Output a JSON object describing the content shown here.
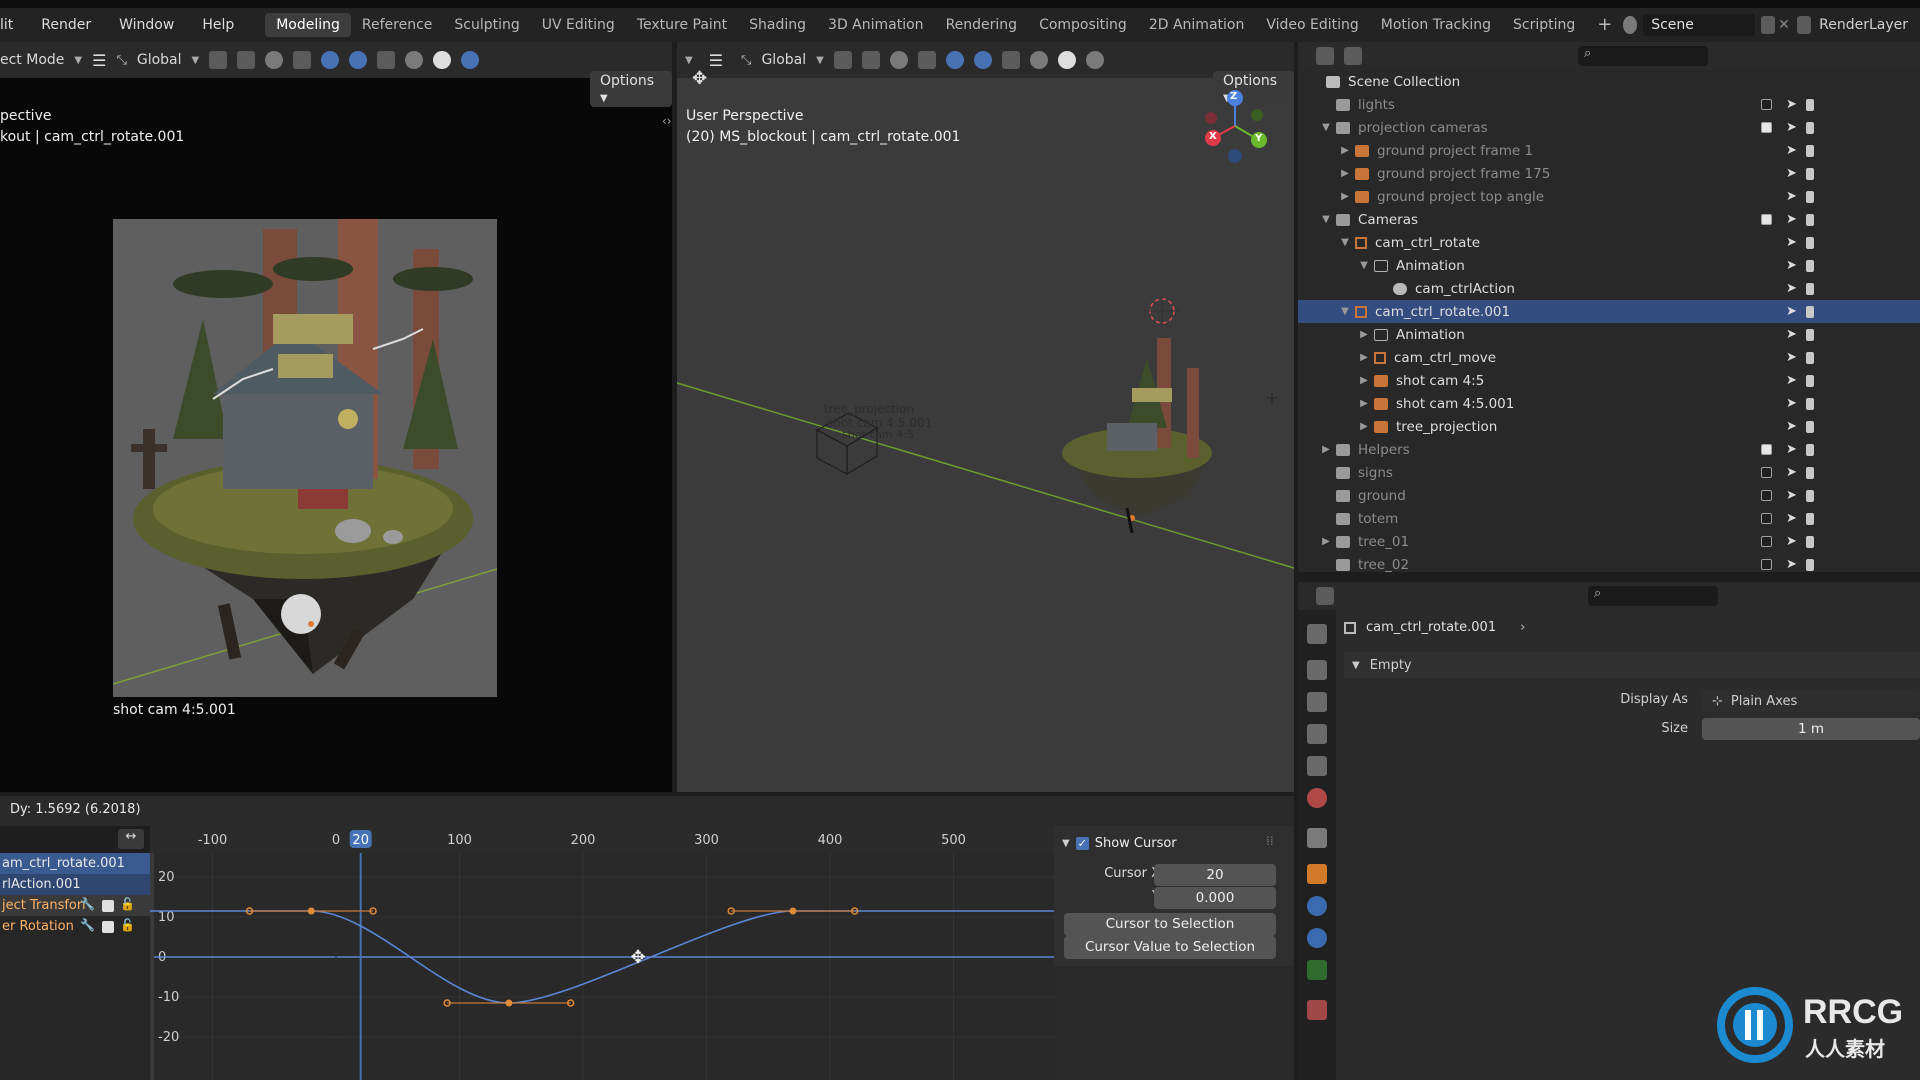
{
  "menubar": {
    "menus": [
      "lit",
      "Render",
      "Window",
      "Help"
    ],
    "workspace_tabs": [
      "Modeling",
      "Reference",
      "Sculpting",
      "UV Editing",
      "Texture Paint",
      "Shading",
      "3D Animation",
      "Rendering",
      "Compositing",
      "2D Animation",
      "Video Editing",
      "Motion Tracking",
      "Scripting"
    ],
    "active_workspace": "Modeling",
    "add_tab": "+",
    "scene_name": "Scene",
    "view_layer": "RenderLayer"
  },
  "left_viewport": {
    "mode": "ect Mode",
    "orientation": "Global",
    "options_label": "Options",
    "perspective_label": "pective",
    "object_label": "kout | cam_ctrl_rotate.001",
    "camera_caption": "shot cam 4:5.001"
  },
  "right_viewport": {
    "orientation": "Global",
    "options_label": "Options",
    "perspective_label": "User Perspective",
    "object_label": "(20) MS_blockout | cam_ctrl_rotate.001",
    "ghost_labels": [
      "tree_projection",
      "shot cam 4:5.001",
      "shot cam 4:5"
    ],
    "gizmo_axes": [
      "Z",
      "Y",
      "X"
    ]
  },
  "outliner": {
    "title": "Scene Collection",
    "rows": [
      {
        "label": "lights",
        "depth": 1,
        "tri": "",
        "icon": "collection",
        "dim": true,
        "check": false,
        "selected": false
      },
      {
        "label": "projection cameras",
        "depth": 1,
        "tri": "▼",
        "icon": "collection",
        "dim": true,
        "check": true,
        "selected": false
      },
      {
        "label": "ground project frame 1",
        "depth": 2,
        "tri": "▶",
        "icon": "camera",
        "dim": true,
        "check": null,
        "selected": false
      },
      {
        "label": "ground project frame 175",
        "depth": 2,
        "tri": "▶",
        "icon": "camera",
        "dim": true,
        "check": null,
        "selected": false
      },
      {
        "label": "ground project top angle",
        "depth": 2,
        "tri": "▶",
        "icon": "camera",
        "dim": true,
        "check": null,
        "selected": false
      },
      {
        "label": "Cameras",
        "depth": 1,
        "tri": "▼",
        "icon": "collection",
        "dim": false,
        "check": true,
        "selected": false
      },
      {
        "label": "cam_ctrl_rotate",
        "depth": 2,
        "tri": "▼",
        "icon": "empty",
        "dim": false,
        "check": null,
        "selected": false
      },
      {
        "label": "Animation",
        "depth": 3,
        "tri": "▼",
        "icon": "anim",
        "dim": false,
        "check": null,
        "selected": false
      },
      {
        "label": "cam_ctrlAction",
        "depth": 4,
        "tri": "",
        "icon": "action",
        "dim": false,
        "check": null,
        "selected": false
      },
      {
        "label": "cam_ctrl_rotate.001",
        "depth": 2,
        "tri": "▼",
        "icon": "empty",
        "dim": false,
        "check": null,
        "selected": true
      },
      {
        "label": "Animation",
        "depth": 3,
        "tri": "▶",
        "icon": "anim",
        "dim": false,
        "check": null,
        "selected": false
      },
      {
        "label": "cam_ctrl_move",
        "depth": 3,
        "tri": "▶",
        "icon": "empty",
        "dim": false,
        "check": null,
        "selected": false
      },
      {
        "label": "shot cam 4:5",
        "depth": 3,
        "tri": "▶",
        "icon": "camera",
        "dim": false,
        "check": null,
        "selected": false
      },
      {
        "label": "shot cam 4:5.001",
        "depth": 3,
        "tri": "▶",
        "icon": "camera",
        "dim": false,
        "check": null,
        "selected": false
      },
      {
        "label": "tree_projection",
        "depth": 3,
        "tri": "▶",
        "icon": "camera",
        "dim": false,
        "check": null,
        "selected": false
      },
      {
        "label": "Helpers",
        "depth": 1,
        "tri": "▶",
        "icon": "collection",
        "dim": true,
        "check": true,
        "selected": false
      },
      {
        "label": "signs",
        "depth": 1,
        "tri": "",
        "icon": "collection",
        "dim": true,
        "check": false,
        "selected": false
      },
      {
        "label": "ground",
        "depth": 1,
        "tri": "",
        "icon": "collection",
        "dim": true,
        "check": false,
        "selected": false
      },
      {
        "label": "totem",
        "depth": 1,
        "tri": "",
        "icon": "collection",
        "dim": true,
        "check": false,
        "selected": false
      },
      {
        "label": "tree_01",
        "depth": 1,
        "tri": "▶",
        "icon": "collection",
        "dim": true,
        "check": false,
        "selected": false
      },
      {
        "label": "tree_02",
        "depth": 1,
        "tri": "",
        "icon": "collection",
        "dim": true,
        "check": false,
        "selected": false
      }
    ]
  },
  "properties": {
    "object_name": "cam_ctrl_rotate.001",
    "breadcrumb_arrow": "›",
    "panel_title": "Empty",
    "display_as_label": "Display As",
    "display_as_value": "Plain Axes",
    "size_label": "Size",
    "size_value": "1 m"
  },
  "graph_editor": {
    "status": "Dy: 1.5692 (6.2018)",
    "current_frame": "20",
    "frame_ticks": [
      "-100",
      "0",
      "100",
      "200",
      "300",
      "400",
      "500"
    ],
    "value_ticks": [
      "20",
      "10",
      "0",
      "-10",
      "-20"
    ],
    "channels": [
      "am_ctrl_rotate.001",
      "rlAction.001",
      "ject Transforr",
      "er Rotation"
    ],
    "show_cursor_label": "Show Cursor",
    "cursor_x_label": "Cursor X",
    "cursor_x_value": "20",
    "cursor_y_label": "Y",
    "cursor_y_value": "0.000",
    "cursor_to_selection": "Cursor to Selection",
    "cursor_value_to_selection": "Cursor Value to Selection",
    "curve_keyframes": [
      {
        "frame": -20,
        "value": 11.5
      },
      {
        "frame": 140,
        "value": -11.5
      },
      {
        "frame": 370,
        "value": 11.5
      }
    ]
  },
  "watermark": {
    "brand": "RRCG",
    "sub": "人人素材"
  },
  "colors": {
    "accent_blue": "#4772b3",
    "selection_row": "#334d80",
    "curve": "#5b86d6",
    "keyframe": "#e08a3a",
    "x_axis_line": "#6c9c2e"
  }
}
